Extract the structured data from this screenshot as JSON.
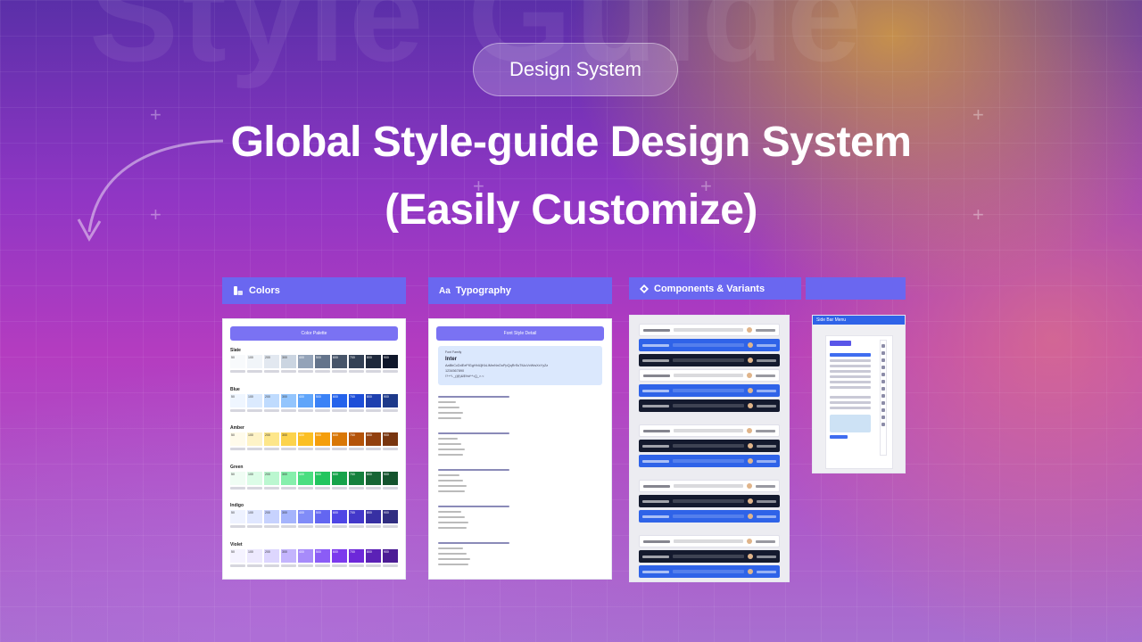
{
  "badge": "Design System",
  "title": {
    "line1": "Global Style-guide Design System",
    "line2": "(Easily Customize)"
  },
  "background_word": "Style Guide",
  "sections": {
    "colors": {
      "label": "Colors",
      "icon": "palette-icon"
    },
    "typography": {
      "label": "Typography",
      "icon_text": "Aa"
    },
    "components": {
      "label": "Components & Variants",
      "icon": "diamond-icon"
    }
  },
  "colors_card": {
    "header_button": "Color Palette",
    "steps": [
      "50",
      "100",
      "200",
      "300",
      "400",
      "500",
      "600",
      "700",
      "800",
      "900"
    ],
    "groups": [
      {
        "name": "Slate",
        "swatches": [
          "#f8fafc",
          "#f1f5f9",
          "#e2e8f0",
          "#cbd5e1",
          "#94a3b8",
          "#64748b",
          "#475569",
          "#334155",
          "#1e293b",
          "#0f172a"
        ]
      },
      {
        "name": "Blue",
        "swatches": [
          "#eff6ff",
          "#dbeafe",
          "#bfdbfe",
          "#93c5fd",
          "#60a5fa",
          "#3b82f6",
          "#2563eb",
          "#1d4ed8",
          "#1e40af",
          "#1e3a8a"
        ]
      },
      {
        "name": "Amber",
        "swatches": [
          "#fffbeb",
          "#fef3c7",
          "#fde68a",
          "#fcd34d",
          "#fbbf24",
          "#f59e0b",
          "#d97706",
          "#b45309",
          "#92400e",
          "#78350f"
        ]
      },
      {
        "name": "Green",
        "swatches": [
          "#f0fdf4",
          "#dcfce7",
          "#bbf7d0",
          "#86efac",
          "#4ade80",
          "#22c55e",
          "#16a34a",
          "#15803d",
          "#166534",
          "#14532d"
        ]
      },
      {
        "name": "Indigo",
        "swatches": [
          "#eef2ff",
          "#e0e7ff",
          "#c7d2fe",
          "#a5b4fc",
          "#818cf8",
          "#6366f1",
          "#4f46e5",
          "#4338ca",
          "#3730a3",
          "#312e81"
        ]
      },
      {
        "name": "Violet",
        "swatches": [
          "#f5f3ff",
          "#ede9fe",
          "#ddd6fe",
          "#c4b5fd",
          "#a78bfa",
          "#8b5cf6",
          "#7c3aed",
          "#6d28d9",
          "#5b21b6",
          "#4c1d95"
        ]
      }
    ]
  },
  "typography_card": {
    "header_button": "Font Style Detail",
    "font_family_label": "Font Family",
    "font_name": "Inter",
    "alphabet": "AaBbCcDdEeFfGgHhIiJjKkLlMmNnOoPpQqRrSsTtUuVvWwXxYyZz",
    "digits": "1234567890",
    "symbols": "!?+*/-_(@)&$%#^*={}_>.<"
  },
  "sidebar_card": {
    "label": "Side Bar Menu"
  },
  "colors": {
    "accent": "#6a67f0",
    "blue": "#2f63e8",
    "dark": "#141a2e"
  }
}
